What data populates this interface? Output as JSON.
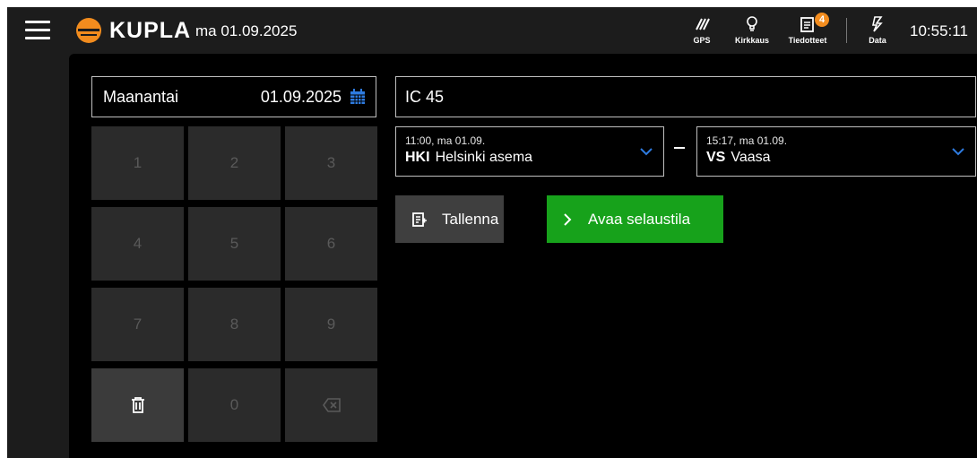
{
  "header": {
    "app_name": "KUPLA",
    "date": "ma 01.09.2025",
    "gps_label": "GPS",
    "brightness_label": "Kirkkaus",
    "notices_label": "Tiedotteet",
    "notices_count": "4",
    "data_label": "Data",
    "time": "10:55:11"
  },
  "date_picker": {
    "weekday": "Maanantai",
    "date": "01.09.2025"
  },
  "keypad": {
    "keys": [
      "1",
      "2",
      "3",
      "4",
      "5",
      "6",
      "7",
      "8",
      "9",
      "0"
    ]
  },
  "train": {
    "number": "IC 45"
  },
  "departure": {
    "time": "11:00, ma 01.09.",
    "code": "HKI",
    "name": "Helsinki asema"
  },
  "arrival": {
    "time": "15:17, ma 01.09.",
    "code": "VS",
    "name": "Vaasa"
  },
  "actions": {
    "save_label": "Tallenna",
    "open_label": "Avaa selaustila"
  },
  "colors": {
    "accent_orange": "#f28c1e",
    "green": "#17a21b",
    "calendar_blue": "#2e7be0"
  }
}
